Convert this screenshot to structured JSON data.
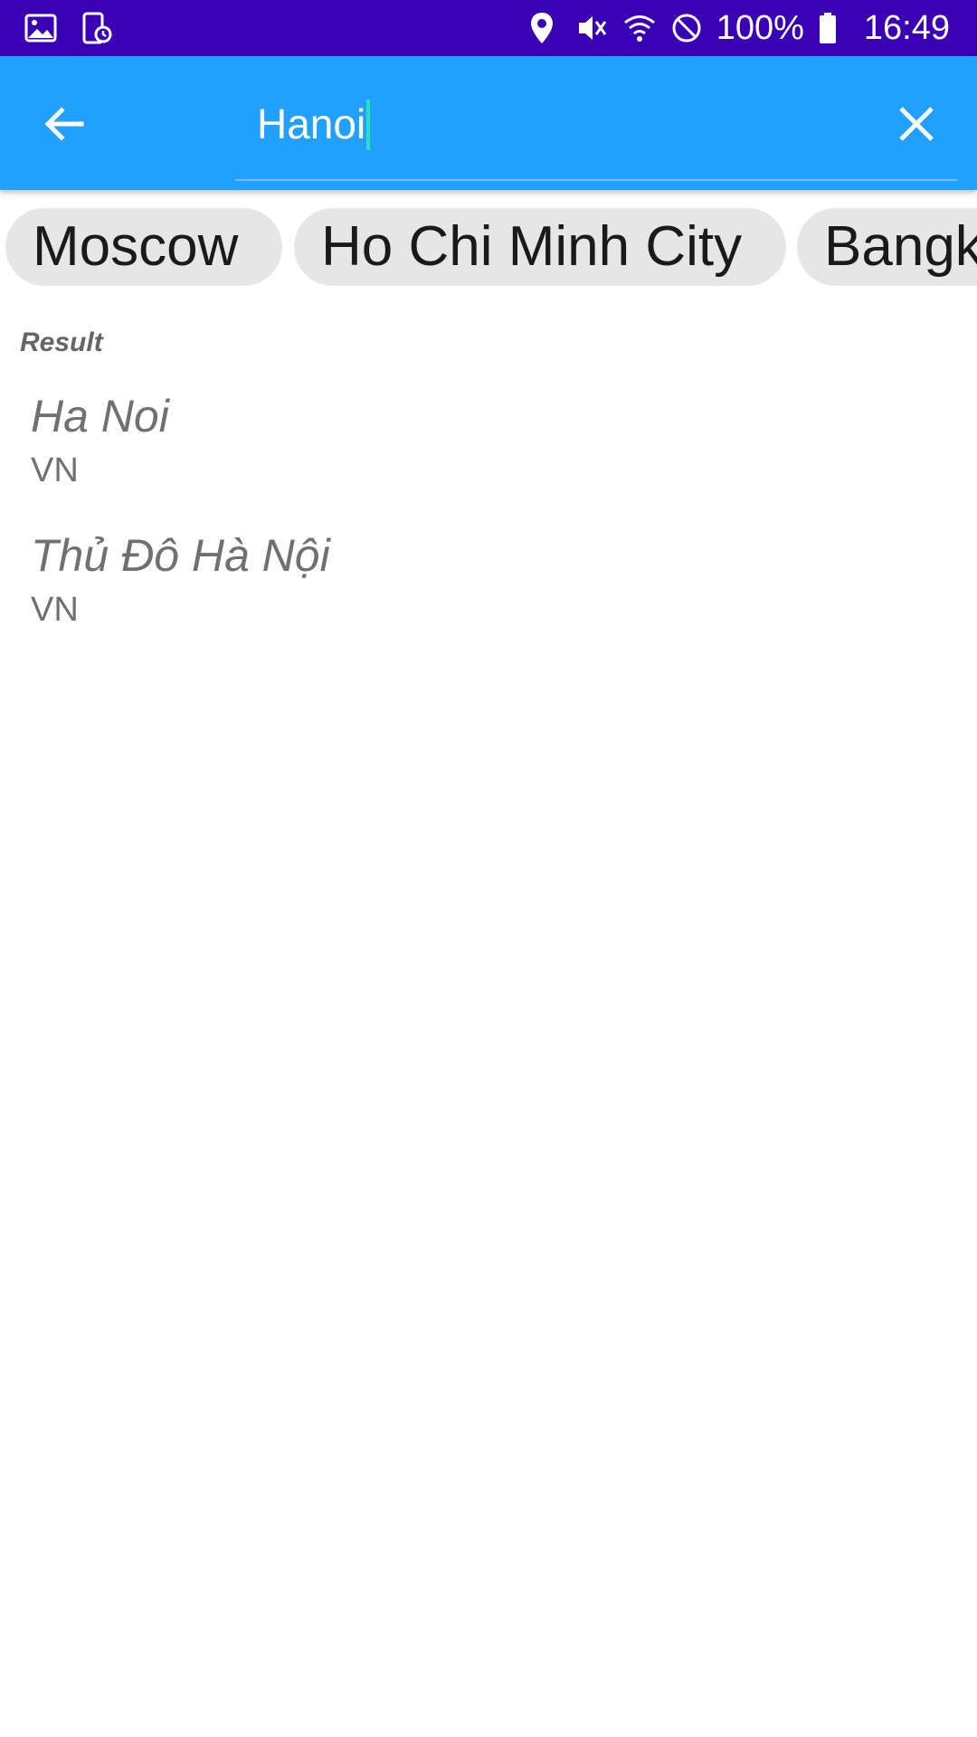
{
  "status_bar": {
    "left_icons": [
      "image-icon",
      "screenshot-icon"
    ],
    "right_icons": [
      "location-icon",
      "vibrate-mute-icon",
      "wifi-icon",
      "blocked-icon",
      "battery-icon"
    ],
    "battery": "100%",
    "time": "16:49"
  },
  "app_bar": {
    "back_icon": "arrow-left-icon",
    "search_value": "Hanoi",
    "clear_icon": "close-icon",
    "background": "#21a0ff"
  },
  "chips": [
    "Moscow",
    "Ho Chi Minh City",
    "Bangk"
  ],
  "results": {
    "title": "Result",
    "items": [
      {
        "name": "Ha Noi",
        "country": "VN"
      },
      {
        "name": "Thủ Đô Hà Nội",
        "country": "VN"
      }
    ]
  },
  "colors": {
    "status_bar": "#3a00b3",
    "app_bar": "#21a0ff",
    "chip_bg": "#e6e6e6",
    "caret": "#29e0c0"
  }
}
